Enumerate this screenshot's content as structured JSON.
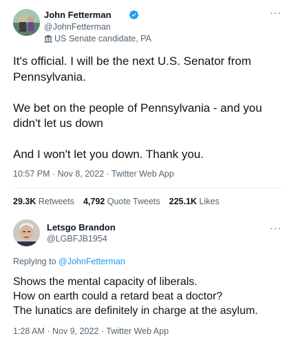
{
  "tweet1": {
    "display_name": "John Fetterman",
    "handle": "@JohnFetterman",
    "account_label": "US Senate candidate, PA",
    "body_lines": [
      "It's official. I will be the next U.S. Senator from",
      "Pennsylvania.",
      "",
      "We bet on the people of Pennsylvania - and you",
      "didn't let us down",
      "",
      "And I won't let you down. Thank you."
    ],
    "timestamp": "10:57 PM · Nov 8, 2022 · Twitter Web App",
    "retweets_count": "29.3K",
    "retweets_label": "Retweets",
    "quotes_count": "4,792",
    "quotes_label": "Quote Tweets",
    "likes_count": "225.1K",
    "likes_label": "Likes",
    "icons": {
      "verified": "verified-badge-icon",
      "label": "government-building-icon",
      "more": "more-options-icon"
    }
  },
  "tweet2": {
    "display_name": "Letsgo Brandon",
    "handle": "@LGBFJB1954",
    "replying_prefix": "Replying to",
    "replying_to": "@JohnFetterman",
    "body_lines": [
      "Shows the mental capacity of liberals.",
      "How on earth could a retard beat a doctor?",
      "The lunatics are definitely in charge at the asylum."
    ],
    "timestamp": "1:28 AM · Nov 9, 2022 · Twitter Web App",
    "icons": {
      "more": "more-options-icon"
    }
  },
  "colors": {
    "primary_text": "#0f1419",
    "secondary_text": "#536471",
    "accent": "#1d9bf0",
    "divider": "#eff3f4"
  }
}
